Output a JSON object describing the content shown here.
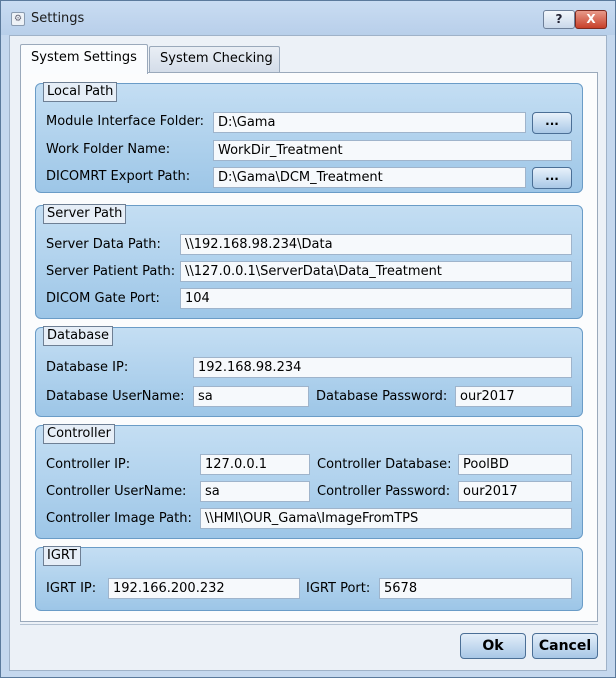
{
  "window": {
    "title": "Settings",
    "help_label": "?",
    "close_label": "X"
  },
  "tabs": [
    {
      "label": "System Settings"
    },
    {
      "label": "System Checking"
    }
  ],
  "local_path": {
    "title": "Local Path",
    "module_label": "Module Interface Folder:",
    "module_value": "D:\\Gama",
    "work_label": "Work Folder Name:",
    "work_value": "WorkDir_Treatment",
    "dicom_label": "DICOMRT Export Path:",
    "dicom_value": "D:\\Gama\\DCM_Treatment",
    "browse_label": "..."
  },
  "server_path": {
    "title": "Server Path",
    "data_label": "Server Data Path:",
    "data_value": "\\\\192.168.98.234\\Data",
    "patient_label": "Server Patient Path:",
    "patient_value": "\\\\127.0.0.1\\ServerData\\Data_Treatment",
    "gate_label": "DICOM Gate Port:",
    "gate_value": "104"
  },
  "database": {
    "title": "Database",
    "ip_label": "Database IP:",
    "ip_value": "192.168.98.234",
    "user_label": "Database UserName:",
    "user_value": "sa",
    "pass_label": "Database Password:",
    "pass_value": "our2017"
  },
  "controller": {
    "title": "Controller",
    "ip_label": "Controller IP:",
    "ip_value": "127.0.0.1",
    "db_label": "Controller Database:",
    "db_value": "PoolBD",
    "user_label": "Controller UserName:",
    "user_value": "sa",
    "pass_label": "Controller Password:",
    "pass_value": "our2017",
    "image_label": "Controller Image Path:",
    "image_value": "\\\\HMI\\OUR_Gama\\ImageFromTPS"
  },
  "igrt": {
    "title": "IGRT",
    "ip_label": "IGRT IP:",
    "ip_value": "192.166.200.232",
    "port_label": "IGRT Port:",
    "port_value": "5678"
  },
  "buttons": {
    "ok": "Ok",
    "cancel": "Cancel"
  }
}
